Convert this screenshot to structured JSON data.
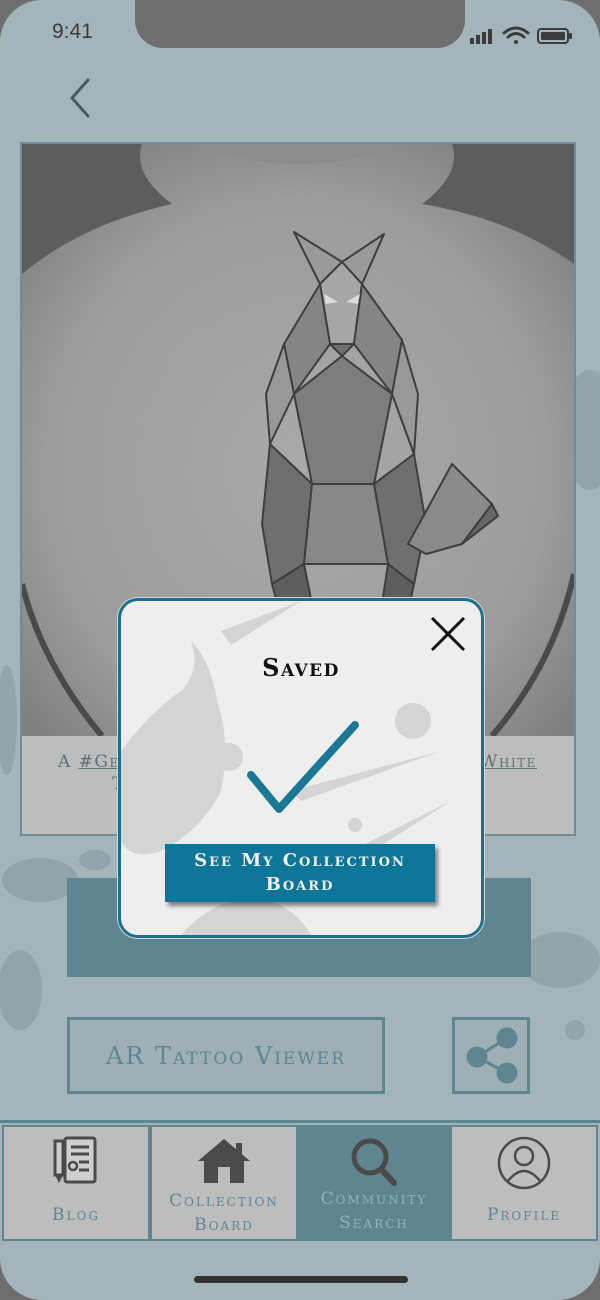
{
  "status_bar": {
    "time": "9:41",
    "icons": [
      "signal-icon",
      "wifi-icon",
      "battery-icon"
    ]
  },
  "nav": {
    "back_icon": "chevron-left-icon"
  },
  "post": {
    "caption_start": "A ",
    "caption_tag": "#Ge",
    "caption_end": "White",
    "caption_line2": "T"
  },
  "actions": {
    "ar_label": "AR Tattoo Viewer",
    "share_icon": "share-icon"
  },
  "bottom_nav": {
    "items": [
      {
        "label_line1": "Blog",
        "label_line2": "",
        "icon": "blog-icon"
      },
      {
        "label_line1": "Collection",
        "label_line2": "Board",
        "icon": "home-icon"
      },
      {
        "label_line1": "Community",
        "label_line2": "Search",
        "icon": "search-icon"
      },
      {
        "label_line1": "Profile",
        "label_line2": "",
        "icon": "profile-icon"
      }
    ],
    "active_index": 2
  },
  "modal": {
    "title": "Saved",
    "button_label": "See My Collection Board",
    "close_icon": "close-icon",
    "check_icon": "checkmark-icon"
  },
  "colors": {
    "accent": "#0e7799",
    "teal_dark": "#5f8590",
    "background": "#a3b5ba"
  }
}
